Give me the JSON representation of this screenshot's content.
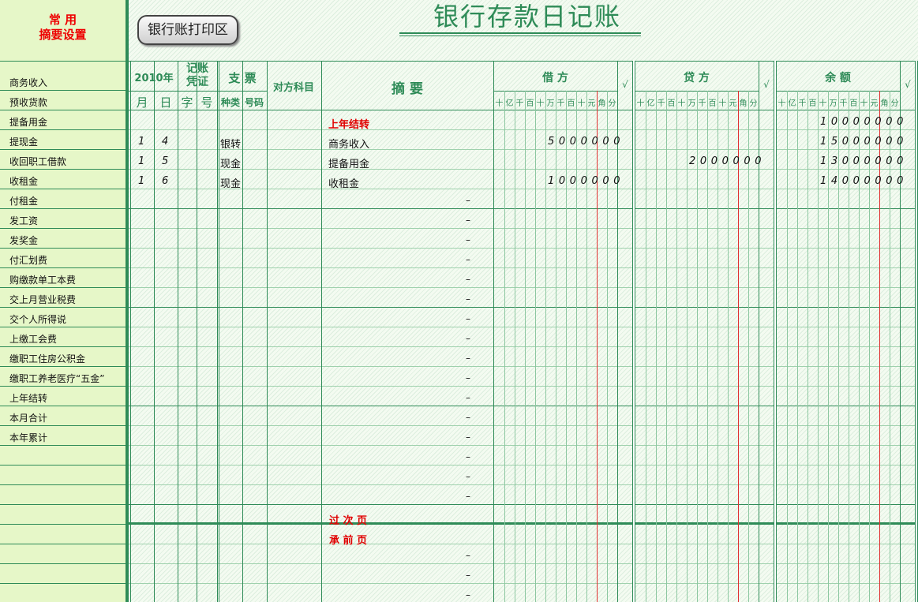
{
  "sidebar": {
    "title_line1": "常  用",
    "title_line2": "摘要设置",
    "items": [
      "商务收入",
      "预收货款",
      "提备用金",
      "提现金",
      "收回职工借款",
      "收租金",
      "付租金",
      "发工资",
      "发奖金",
      "付汇划费",
      "购缴款单工本费",
      "交上月营业税费",
      "交个人所得说",
      "上缴工会费",
      "缴职工住房公积金",
      "缴职工养老医疗“五金”",
      "上年结转",
      "本月合计",
      "本年累计"
    ]
  },
  "toolbar": {
    "print_button": "银行账打印区"
  },
  "ledger": {
    "title": "银行存款日记账",
    "headers": {
      "year": "2010年",
      "voucher_top": "记账",
      "voucher_bottom": "凭证",
      "cheque": "支    票",
      "account": "对方科目",
      "summary": "摘            要",
      "debit": "借          方",
      "credit": "贷          方",
      "balance": "余          额",
      "check": "√",
      "month": "月",
      "day": "日",
      "voucher_word": "字",
      "voucher_no": "号",
      "cheque_type": "种类",
      "cheque_no": "号码",
      "digit_units": [
        "十",
        "亿",
        "千",
        "百",
        "十",
        "万",
        "千",
        "百",
        "十",
        "元",
        "角",
        "分"
      ]
    },
    "rows": [
      {
        "month": "",
        "day": "",
        "type": "",
        "summary": "上年结转",
        "debit": "",
        "credit": "",
        "balance": "10000000",
        "summary_red": true
      },
      {
        "month": "1",
        "day": "4",
        "type": "银转",
        "summary": "商务收入",
        "debit": "5000000",
        "credit": "",
        "balance": "15000000"
      },
      {
        "month": "1",
        "day": "5",
        "type": "现金",
        "summary": "提备用金",
        "debit": "",
        "credit": "2000000",
        "balance": "13000000"
      },
      {
        "month": "1",
        "day": "6",
        "type": "现金",
        "summary": "收租金",
        "debit": "1000000",
        "credit": "",
        "balance": "14000000"
      }
    ],
    "dash_mark": "–",
    "carry_forward": "过  次  页",
    "brought_forward": "承  前  页"
  }
}
